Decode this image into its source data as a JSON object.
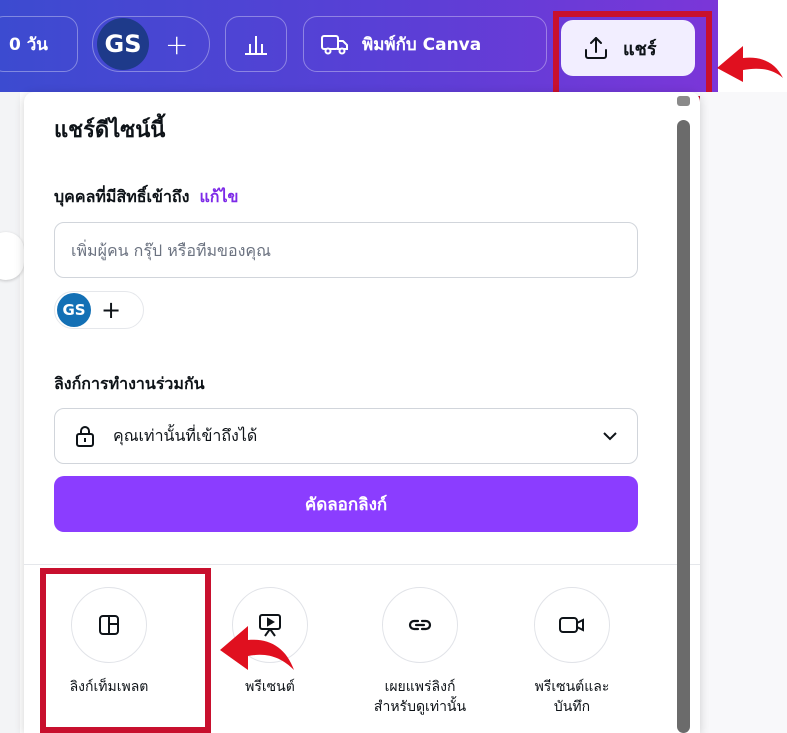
{
  "topbar": {
    "trial_text": "0 วัน",
    "avatar_initials": "GS",
    "add_label": "+",
    "print_label": "พิมพ์กับ Canva",
    "share_label": "แชร์"
  },
  "panel": {
    "title": "แชร์ดีไซน์นี้",
    "access_label": "บุคคลที่มีสิทธิ์เข้าถึง",
    "edit_label": "แก้ไข",
    "people_placeholder": "เพิ่มผู้คน กรุ๊ป หรือทีมของคุณ",
    "team_initials": "GS",
    "team_add": "+",
    "collab_label": "ลิงก์การทำงานร่วมกัน",
    "access_value": "คุณเท่านั้นที่เข้าถึงได้",
    "copy_link_label": "คัดลอกลิงก์",
    "actions": [
      {
        "label": "ลิงก์เท็มเพลต",
        "icon": "template-icon"
      },
      {
        "label": "พรีเซนต์",
        "icon": "present-icon"
      },
      {
        "label": "เผยแพร่ลิงก์\nสำหรับดูเท่านั้น",
        "icon": "link-icon"
      },
      {
        "label": "พรีเซนต์และ\nบันทึก",
        "icon": "video-camera-icon"
      }
    ]
  },
  "colors": {
    "topbar_gradient_start": "#3c4bd0",
    "topbar_gradient_end": "#7b36d8",
    "accent_purple": "#8b3dff",
    "edit_link": "#7d2ae8",
    "highlight_red": "#c8102e"
  }
}
